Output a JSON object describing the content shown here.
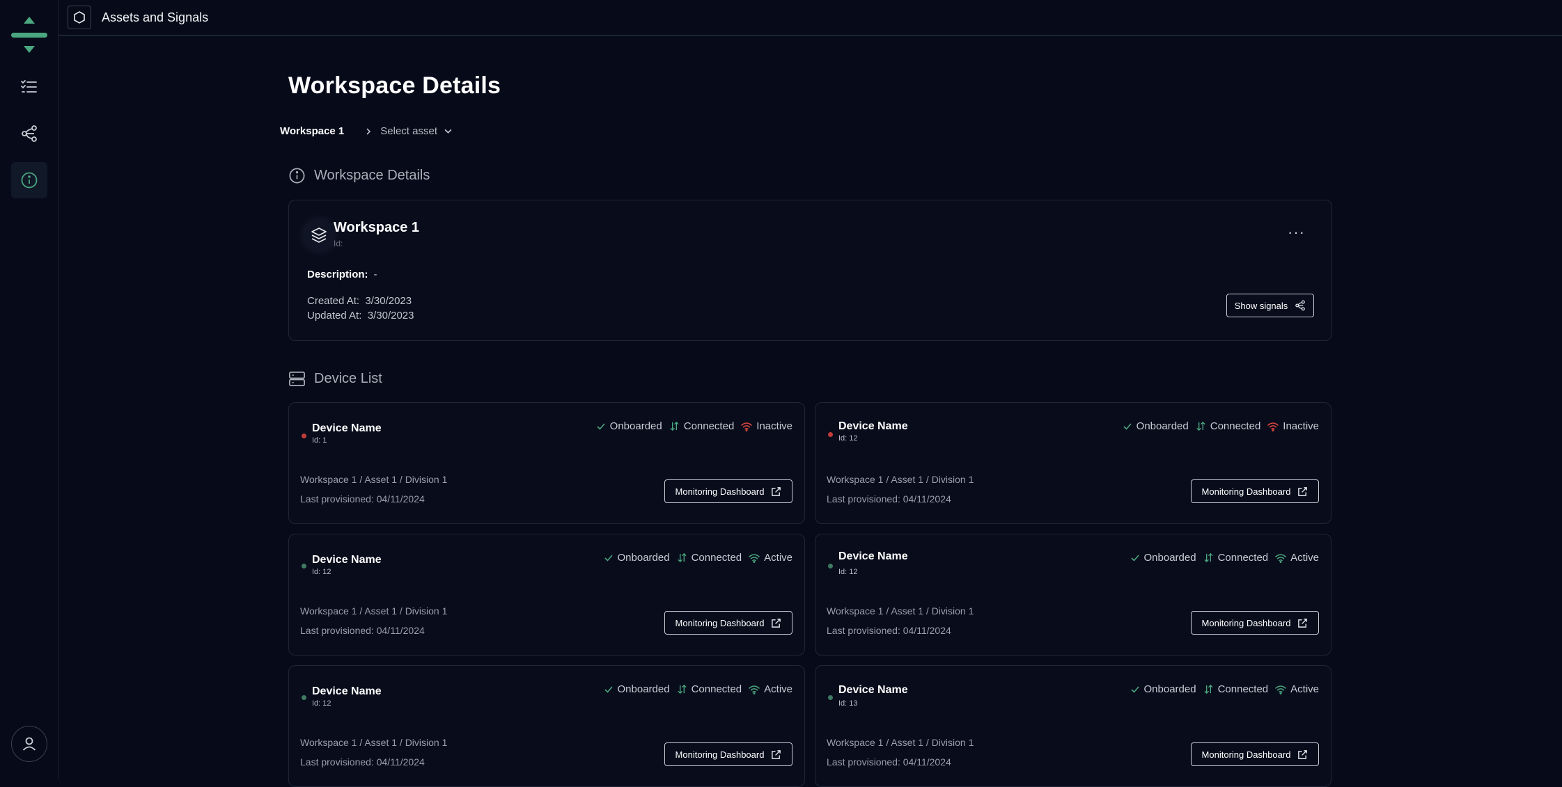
{
  "app": {
    "title": "Assets and Signals"
  },
  "page": {
    "title": "Workspace Details"
  },
  "breadcrumb": {
    "workspace": "Workspace 1",
    "asset": "Select asset"
  },
  "workspace_section": {
    "title": "Workspace Details"
  },
  "workspace": {
    "name": "Workspace 1",
    "id_label": "Id:",
    "description_label": "Description:",
    "description_value": "-",
    "created_label": "Created At:",
    "created_value": "3/30/2023",
    "updated_label": "Updated At:",
    "updated_value": "3/30/2023",
    "show_signals_label": "Show signals",
    "more_label": "···"
  },
  "device_section": {
    "title": "Device List"
  },
  "devices": [
    {
      "name": "Device Name",
      "id": "Id: 1",
      "onboarded": "Onboarded",
      "connected": "Connected",
      "activity": "Inactive",
      "path": "Workspace 1 / Asset 1 / Division 1",
      "provisioned": "Last provisioned: 04/11/2024",
      "button": "Monitoring Dashboard"
    },
    {
      "name": "Device Name",
      "id": "Id: 12",
      "onboarded": "Onboarded",
      "connected": "Connected",
      "activity": "Inactive",
      "path": "Workspace 1 / Asset 1 / Division 1",
      "provisioned": "Last provisioned: 04/11/2024",
      "button": "Monitoring Dashboard"
    },
    {
      "name": "Device Name",
      "id": "Id: 12",
      "onboarded": "Onboarded",
      "connected": "Connected",
      "activity": "Active",
      "path": "Workspace 1 / Asset 1 / Division 1",
      "provisioned": "Last provisioned: 04/11/2024",
      "button": "Monitoring Dashboard"
    },
    {
      "name": "Device Name",
      "id": "Id: 12",
      "onboarded": "Onboarded",
      "connected": "Connected",
      "activity": "Active",
      "path": "Workspace 1 / Asset 1 / Division 1",
      "provisioned": "Last provisioned: 04/11/2024",
      "button": "Monitoring Dashboard"
    },
    {
      "name": "Device Name",
      "id": "Id: 12",
      "onboarded": "Onboarded",
      "connected": "Connected",
      "activity": "Active",
      "path": "Workspace 1 / Asset 1 / Division 1",
      "provisioned": "Last provisioned: 04/11/2024",
      "button": "Monitoring Dashboard"
    },
    {
      "name": "Device Name",
      "id": "Id: 13",
      "onboarded": "Onboarded",
      "connected": "Connected",
      "activity": "Active",
      "path": "Workspace 1 / Asset 1 / Division 1",
      "provisioned": "Last provisioned: 04/11/2024",
      "button": "Monitoring Dashboard"
    }
  ],
  "colors": {
    "accent": "#4aa77f",
    "inactive": "#e0483f",
    "background": "#070b19",
    "border": "#1f2737"
  },
  "icons": {
    "logo": "arrows-logo-icon",
    "list": "list-icon",
    "signals": "graph-nodes-icon",
    "info": "info-icon",
    "user": "user-icon",
    "app": "hexagon-icon"
  }
}
